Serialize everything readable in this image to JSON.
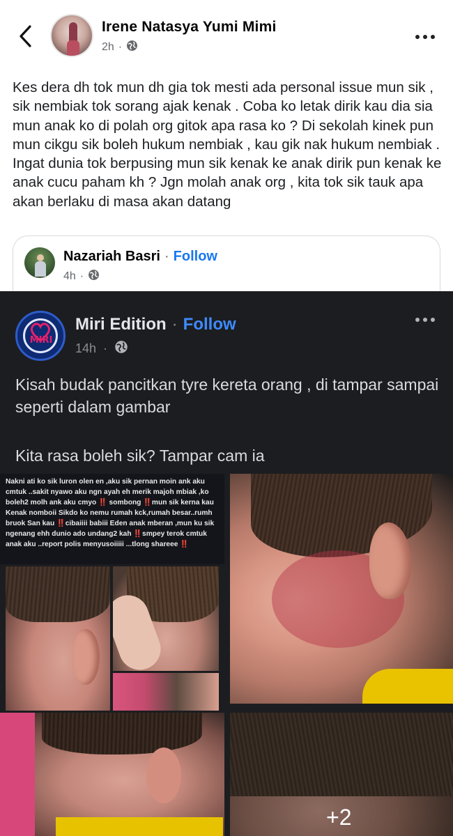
{
  "header": {
    "author": "Irene Natasya Yumi Mimi",
    "time": "2h",
    "dot": "·"
  },
  "post": {
    "text": "Kes dera dh tok mun dh gia tok mesti ada personal issue mun sik , sik nembiak tok sorang ajak kenak . Coba ko letak dirik kau dia sia mun anak ko di polah org gitok apa rasa ko ? Di sekolah kinek pun mun cikgu sik boleh hukum nembiak , kau gik nak hukum nembiak . Ingat dunia tok berpusing mun sik kenak ke anak dirik pun kenak ke anak cucu paham kh ? Jgn molah anak org , kita tok sik tauk apa akan berlaku di masa akan datang"
  },
  "shared": {
    "author": "Nazariah Basri",
    "dot": "·",
    "follow": "Follow",
    "time": "4h"
  },
  "embedded": {
    "page": "Miri Edition",
    "dot": "·",
    "follow": "Follow",
    "time": "14h",
    "logo_text": "MIRI",
    "text1": "Kisah budak pancitkan tyre kereta orang , di tampar sampai seperti dalam gambar",
    "text2": "Kita rasa boleh sik? Tampar cam ia",
    "note": "Nakni ati ko sik luron olen en ,aku sik pernan moin ank aku cmtuk ..sakit nyawo aku ngn ayah eh merik majoh mbiak ,ko boleh2 molh ank aku cmyo ‼️ sombong ‼️mun sik kerna kau Kenak nomboii Sikdo ko nemu rumah kck,rumah besar..rumh bruok San kau ‼️cibaiiii babiii Eden anak mberan ,mun ku sik ngenang ehh dunio ado undang2 kah ‼️smpey terok cmtuk anak aku ..report polis menyusoiiiii ...tlong shareee ‼️",
    "more_photos": "+2"
  },
  "colors": {
    "follow_light": "#1877f2",
    "follow_dark": "#3d8bff",
    "dark_bg": "#1c1d20"
  },
  "icons": [
    "back-arrow-icon",
    "globe-icon",
    "more-options-icon"
  ]
}
